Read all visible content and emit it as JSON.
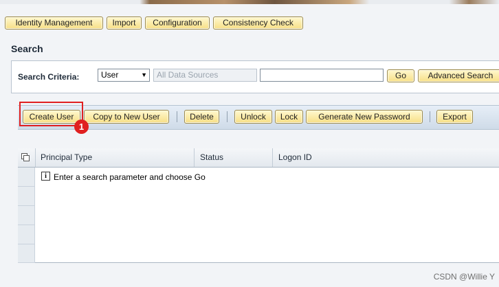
{
  "header": {
    "tabs": [
      "Identity Management",
      "Import",
      "Configuration",
      "Consistency Check"
    ]
  },
  "search": {
    "section_title": "Search",
    "criteria_label": "Search Criteria:",
    "object_type": "User",
    "data_sources_placeholder": "All Data Sources",
    "query_value": "",
    "go_label": "Go",
    "advanced_label": "Advanced Search"
  },
  "toolbar": {
    "create_user": "Create User",
    "copy_user": "Copy to New User",
    "delete": "Delete",
    "unlock": "Unlock",
    "lock": "Lock",
    "generate_password": "Generate New Password",
    "export": "Export"
  },
  "table": {
    "columns": [
      "Principal Type",
      "Status",
      "Logon ID"
    ],
    "empty_message": "Enter a search parameter and choose Go",
    "info_glyph": "i"
  },
  "annotation": {
    "step_number": "1",
    "color": "#e02020"
  },
  "watermark": "CSDN @Willie  Y",
  "colors": {
    "button_fill": "#f7df86",
    "toolbar": "#cfdbe8",
    "highlight": "#e02020"
  }
}
